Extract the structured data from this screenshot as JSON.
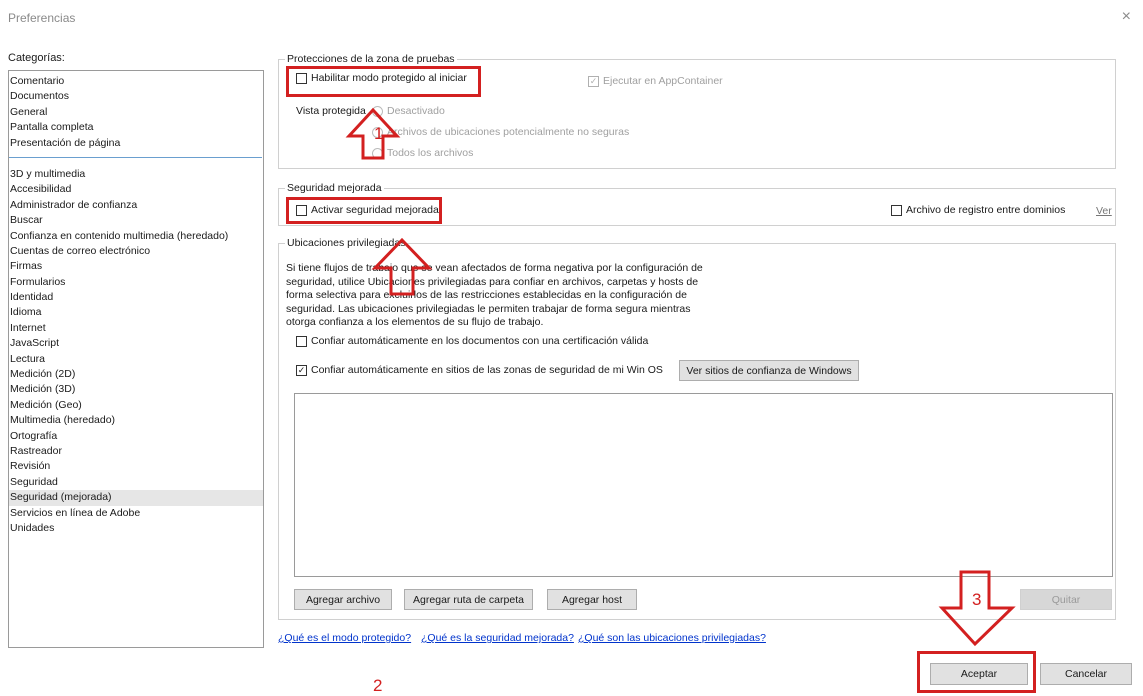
{
  "window": {
    "title": "Preferencias",
    "close_glyph": "×"
  },
  "categories": {
    "label": "Categorías:",
    "top_items": [
      "Comentario",
      "Documentos",
      "General",
      "Pantalla completa",
      "Presentación de página"
    ],
    "items": [
      "3D y multimedia",
      "Accesibilidad",
      "Administrador de confianza",
      "Buscar",
      "Confianza en contenido multimedia (heredado)",
      "Cuentas de correo electrónico",
      "Firmas",
      "Formularios",
      "Identidad",
      "Idioma",
      "Internet",
      "JavaScript",
      "Lectura",
      "Medición (2D)",
      "Medición (3D)",
      "Medición (Geo)",
      "Multimedia (heredado)",
      "Ortografía",
      "Rastreador",
      "Revisión",
      "Seguridad",
      "Seguridad (mejorada)",
      "Servicios en línea de Adobe",
      "Unidades"
    ],
    "selected": "Seguridad (mejorada)"
  },
  "sandbox": {
    "title": "Protecciones de la zona de pruebas",
    "protected_mode_label": "Habilitar modo protegido al iniciar",
    "protected_mode_checked": false,
    "appcontainer_label": "Ejecutar en AppContainer",
    "appcontainer_checked": true,
    "protected_view_label": "Vista protegida",
    "radio_off": "Desactivado",
    "radio_unsafe": "Archivos de ubicaciones potencialmente no seguras",
    "radio_all": "Todos los archivos"
  },
  "enhanced": {
    "title": "Seguridad mejorada",
    "enable_label": "Activar seguridad mejorada",
    "enable_checked": false,
    "log_label": "Archivo de registro entre dominios",
    "log_checked": false,
    "view_link": "Ver"
  },
  "privileged": {
    "title": "Ubicaciones privilegiadas",
    "description": "Si tiene flujos de trabajo que se vean afectados de forma negativa por la configuración de seguridad, utilice Ubicaciones privilegiadas para confiar en archivos, carpetas y hosts de forma selectiva para excluirlos de las restricciones establecidas en la configuración de seguridad. Las ubicaciones privilegiadas le permiten trabajar de forma segura mientras otorga confianza a los elementos de su flujo de trabajo.",
    "trust_cert_label": "Confiar automáticamente en los documentos con una certificación válida",
    "trust_cert_checked": false,
    "trust_win_label": "Confiar automáticamente en sitios de las zonas de seguridad de mi Win OS",
    "trust_win_checked": true,
    "view_sites_button": "Ver sitios de confianza de Windows",
    "add_file_button": "Agregar archivo",
    "add_folder_button": "Agregar ruta de carpeta",
    "add_host_button": "Agregar host",
    "remove_button": "Quitar"
  },
  "help_links": {
    "protected_mode": "¿Qué es el modo protegido?",
    "enhanced_security": "¿Qué es la seguridad mejorada?",
    "privileged_locations": "¿Qué son las ubicaciones privilegiadas?"
  },
  "footer": {
    "ok_button": "Aceptar",
    "cancel_button": "Cancelar"
  },
  "annotations": {
    "step1": "1",
    "step2": "2",
    "step3": "3",
    "color": "#d32020"
  },
  "checkmark_glyph": "✓"
}
